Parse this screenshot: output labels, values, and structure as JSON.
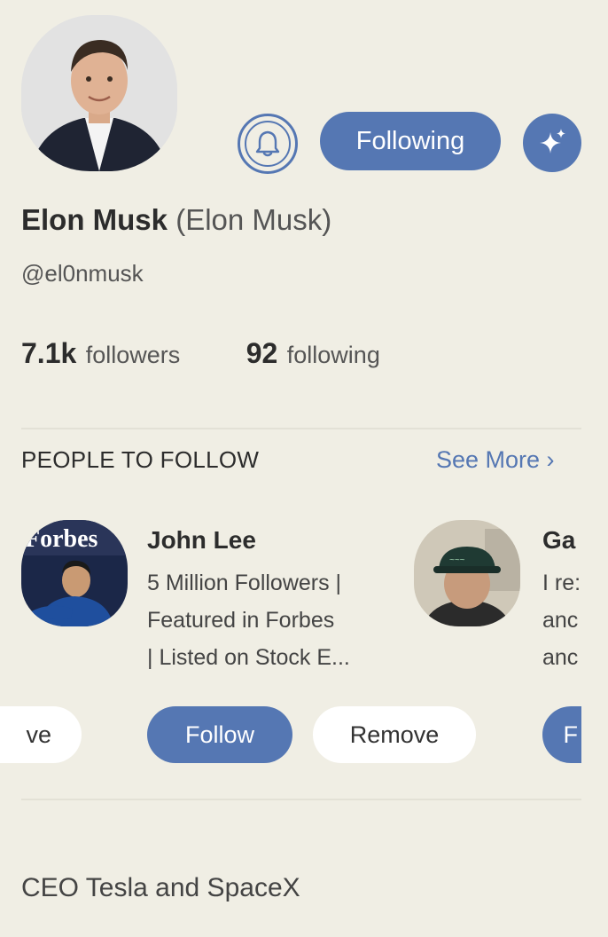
{
  "profile": {
    "name": "Elon Musk",
    "display_name": "(Elon Musk)",
    "handle": "@el0nmusk",
    "followers_count": "7.1k",
    "followers_label": "followers",
    "following_count": "92",
    "following_label": "following",
    "following_button": "Following",
    "bio": "CEO Tesla and SpaceX"
  },
  "people_to_follow": {
    "title": "PEOPLE TO FOLLOW",
    "see_more": "See More ›",
    "left_partial_button": "ve",
    "cards": [
      {
        "name": "John Lee",
        "bio_lines": [
          "5 Million Followers |",
          "Featured in Forbes",
          "| Listed on Stock E..."
        ],
        "avatar_text": "Forbes",
        "follow_label": "Follow",
        "remove_label": "Remove"
      },
      {
        "name": "Ga",
        "bio_lines": [
          "I re:",
          "anc",
          "anc"
        ],
        "follow_label": "F"
      }
    ]
  },
  "colors": {
    "accent": "#5577b3",
    "background": "#f0eee4"
  },
  "icons": [
    "bell-icon",
    "sparkle-icon"
  ]
}
